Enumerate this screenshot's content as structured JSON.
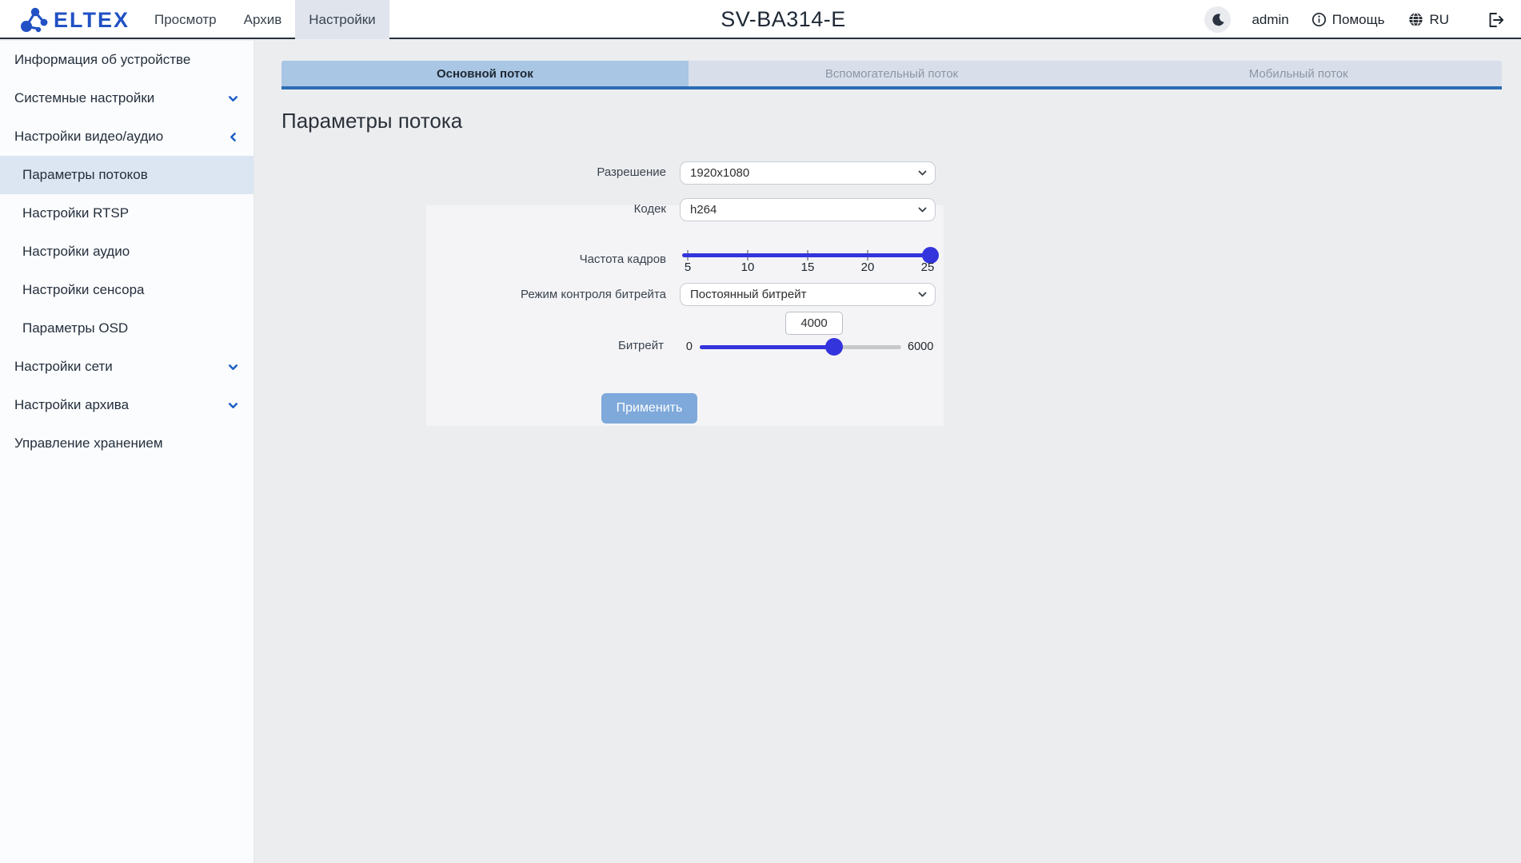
{
  "header": {
    "logo_text": "ELTEX",
    "nav": [
      {
        "label": "Просмотр",
        "active": false
      },
      {
        "label": "Архив",
        "active": false
      },
      {
        "label": "Настройки",
        "active": true
      }
    ],
    "device_title": "SV-BA314-E",
    "user": "admin",
    "help_label": "Помощь",
    "language": "RU"
  },
  "sidebar": {
    "items": [
      {
        "label": "Информация об устройстве",
        "type": "top",
        "chevron": "none",
        "selected": false
      },
      {
        "label": "Системные настройки",
        "type": "top",
        "chevron": "down",
        "selected": false
      },
      {
        "label": "Настройки видео/аудио",
        "type": "top",
        "chevron": "left",
        "selected": false
      },
      {
        "label": "Параметры потоков",
        "type": "sub",
        "chevron": "none",
        "selected": true
      },
      {
        "label": "Настройки RTSP",
        "type": "sub",
        "chevron": "none",
        "selected": false
      },
      {
        "label": "Настройки аудио",
        "type": "sub",
        "chevron": "none",
        "selected": false
      },
      {
        "label": "Настройки сенсора",
        "type": "sub",
        "chevron": "none",
        "selected": false
      },
      {
        "label": "Параметры OSD",
        "type": "sub",
        "chevron": "none",
        "selected": false
      },
      {
        "label": "Настройки сети",
        "type": "top",
        "chevron": "down",
        "selected": false
      },
      {
        "label": "Настройки архива",
        "type": "top",
        "chevron": "down",
        "selected": false
      },
      {
        "label": "Управление хранением",
        "type": "top",
        "chevron": "none",
        "selected": false
      }
    ]
  },
  "tabs": [
    {
      "label": "Основной поток",
      "active": true
    },
    {
      "label": "Вспомогательный поток",
      "active": false
    },
    {
      "label": "Мобильный поток",
      "active": false
    }
  ],
  "page": {
    "title": "Параметры потока"
  },
  "form": {
    "resolution": {
      "label": "Разрешение",
      "value": "1920x1080"
    },
    "codec": {
      "label": "Кодек",
      "value": "h264"
    },
    "framerate": {
      "label": "Частота кадров",
      "min": 5,
      "max": 25,
      "value": 25,
      "ticks": [
        "5",
        "10",
        "15",
        "20",
        "25"
      ]
    },
    "bitrate_mode": {
      "label": "Режим контроля битрейта",
      "value": "Постоянный битрейт"
    },
    "bitrate": {
      "label": "Битрейт",
      "min": 0,
      "max": 6000,
      "value": 4000,
      "input_value": "4000",
      "min_label": "0",
      "max_label": "6000"
    },
    "apply_label": "Применить"
  },
  "icons": [
    "eltex-molecule-icon",
    "moon-icon",
    "info-icon",
    "globe-icon",
    "logout-icon",
    "chevron-down-icon",
    "chevron-left-icon"
  ],
  "colors": {
    "logo": "#2151c4",
    "accent": "#2b6cb4",
    "tab_active_bg": "#a9c6e4",
    "tab_inactive_bg": "#d8dfeb",
    "slider": "#3434dd",
    "sidebar_selected_bg": "#dbe6f2",
    "button_bg": "#7ea9da",
    "header_border": "#232e3a"
  }
}
